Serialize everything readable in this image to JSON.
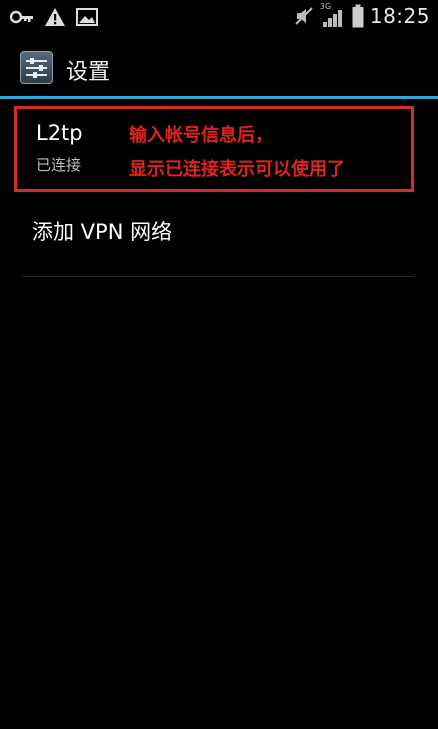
{
  "status_bar": {
    "time": "18:25",
    "network": "3G",
    "icons": [
      "key-icon",
      "warning-icon",
      "image-icon",
      "mute-icon",
      "signal-icon",
      "battery-icon"
    ]
  },
  "action_bar": {
    "title": "设置",
    "icon": "settings-sliders-icon"
  },
  "vpn_list": {
    "items": [
      {
        "name": "L2tp",
        "status": "已连接"
      }
    ],
    "add_label": "添加 VPN 网络"
  },
  "annotation": {
    "line1": "输入帐号信息后，",
    "line2": "显示已连接表示可以使用了"
  },
  "colors": {
    "accent": "#2fa7d8",
    "annotation_red": "#e0231f",
    "box_red": "#d62b2b"
  }
}
